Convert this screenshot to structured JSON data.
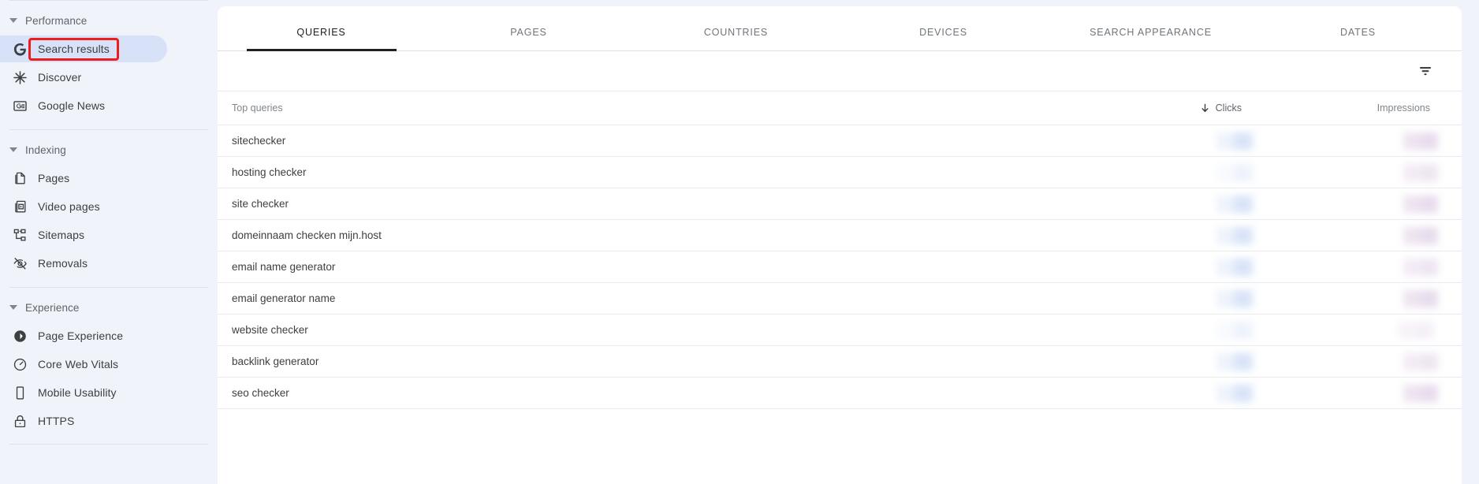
{
  "sidebar": {
    "groups": [
      {
        "name": "performance-group",
        "label": "Performance",
        "caret": "chevron-down-icon",
        "items": [
          {
            "label": "Search results",
            "icon": "google-g-icon",
            "active": true,
            "highlighted": true
          },
          {
            "label": "Discover",
            "icon": "discover-asterisk-icon",
            "active": false,
            "highlighted": false
          },
          {
            "label": "Google News",
            "icon": "google-news-icon",
            "active": false,
            "highlighted": false
          }
        ]
      },
      {
        "name": "indexing-group",
        "label": "Indexing",
        "caret": "chevron-down-icon",
        "items": [
          {
            "label": "Pages",
            "icon": "pages-copy-icon",
            "active": false,
            "highlighted": false
          },
          {
            "label": "Video pages",
            "icon": "video-pages-icon",
            "active": false,
            "highlighted": false
          },
          {
            "label": "Sitemaps",
            "icon": "sitemaps-icon",
            "active": false,
            "highlighted": false
          },
          {
            "label": "Removals",
            "icon": "eye-off-icon",
            "active": false,
            "highlighted": false
          }
        ]
      },
      {
        "name": "experience-group",
        "label": "Experience",
        "caret": "chevron-down-icon",
        "items": [
          {
            "label": "Page Experience",
            "icon": "page-experience-icon",
            "active": false,
            "highlighted": false
          },
          {
            "label": "Core Web Vitals",
            "icon": "speedometer-icon",
            "active": false,
            "highlighted": false
          },
          {
            "label": "Mobile Usability",
            "icon": "mobile-phone-icon",
            "active": false,
            "highlighted": false
          },
          {
            "label": "HTTPS",
            "icon": "lock-icon",
            "active": false,
            "highlighted": false
          }
        ]
      }
    ]
  },
  "main": {
    "tabs": [
      {
        "label": "QUERIES",
        "active": true
      },
      {
        "label": "PAGES",
        "active": false
      },
      {
        "label": "COUNTRIES",
        "active": false
      },
      {
        "label": "DEVICES",
        "active": false
      },
      {
        "label": "SEARCH APPEARANCE",
        "active": false
      },
      {
        "label": "DATES",
        "active": false
      }
    ],
    "filter_icon": "filter-list-icon",
    "table": {
      "headers": {
        "queries": "Top queries",
        "clicks": "Clicks",
        "impressions": "Impressions",
        "sort_icon": "arrow-down-icon",
        "sort_column": "Clicks",
        "sort_direction": "descending"
      },
      "rows": [
        {
          "query": "sitechecker",
          "clicks": "",
          "impressions": "",
          "clicks_level": "strong",
          "impressions_level": "strong"
        },
        {
          "query": "hosting checker",
          "clicks": "",
          "impressions": "",
          "clicks_level": "faint",
          "impressions_level": "mid"
        },
        {
          "query": "site checker",
          "clicks": "",
          "impressions": "",
          "clicks_level": "strong",
          "impressions_level": "strong"
        },
        {
          "query": "domeinnaam checken mijn.host",
          "clicks": "",
          "impressions": "",
          "clicks_level": "strong",
          "impressions_level": "strong"
        },
        {
          "query": "email name generator",
          "clicks": "",
          "impressions": "",
          "clicks_level": "strong",
          "impressions_level": "mid"
        },
        {
          "query": "email generator name",
          "clicks": "",
          "impressions": "",
          "clicks_level": "strong",
          "impressions_level": "strong"
        },
        {
          "query": "website checker",
          "clicks": "",
          "impressions": "",
          "clicks_level": "faint",
          "impressions_level": "faint"
        },
        {
          "query": "backlink generator",
          "clicks": "",
          "impressions": "",
          "clicks_level": "strong",
          "impressions_level": "mid"
        },
        {
          "query": "seo checker",
          "clicks": "",
          "impressions": "",
          "clicks_level": "strong",
          "impressions_level": "strong"
        }
      ]
    }
  },
  "annotation": {
    "highlight_color": "#ee1c1c",
    "target": "Search results"
  },
  "colors": {
    "page_background": "#f1f3fa",
    "card_background": "#ffffff",
    "active_item_background": "#d7e2f8",
    "text_primary": "#3c4043",
    "text_secondary": "#70757a",
    "active_tab_underline": "#202124"
  }
}
